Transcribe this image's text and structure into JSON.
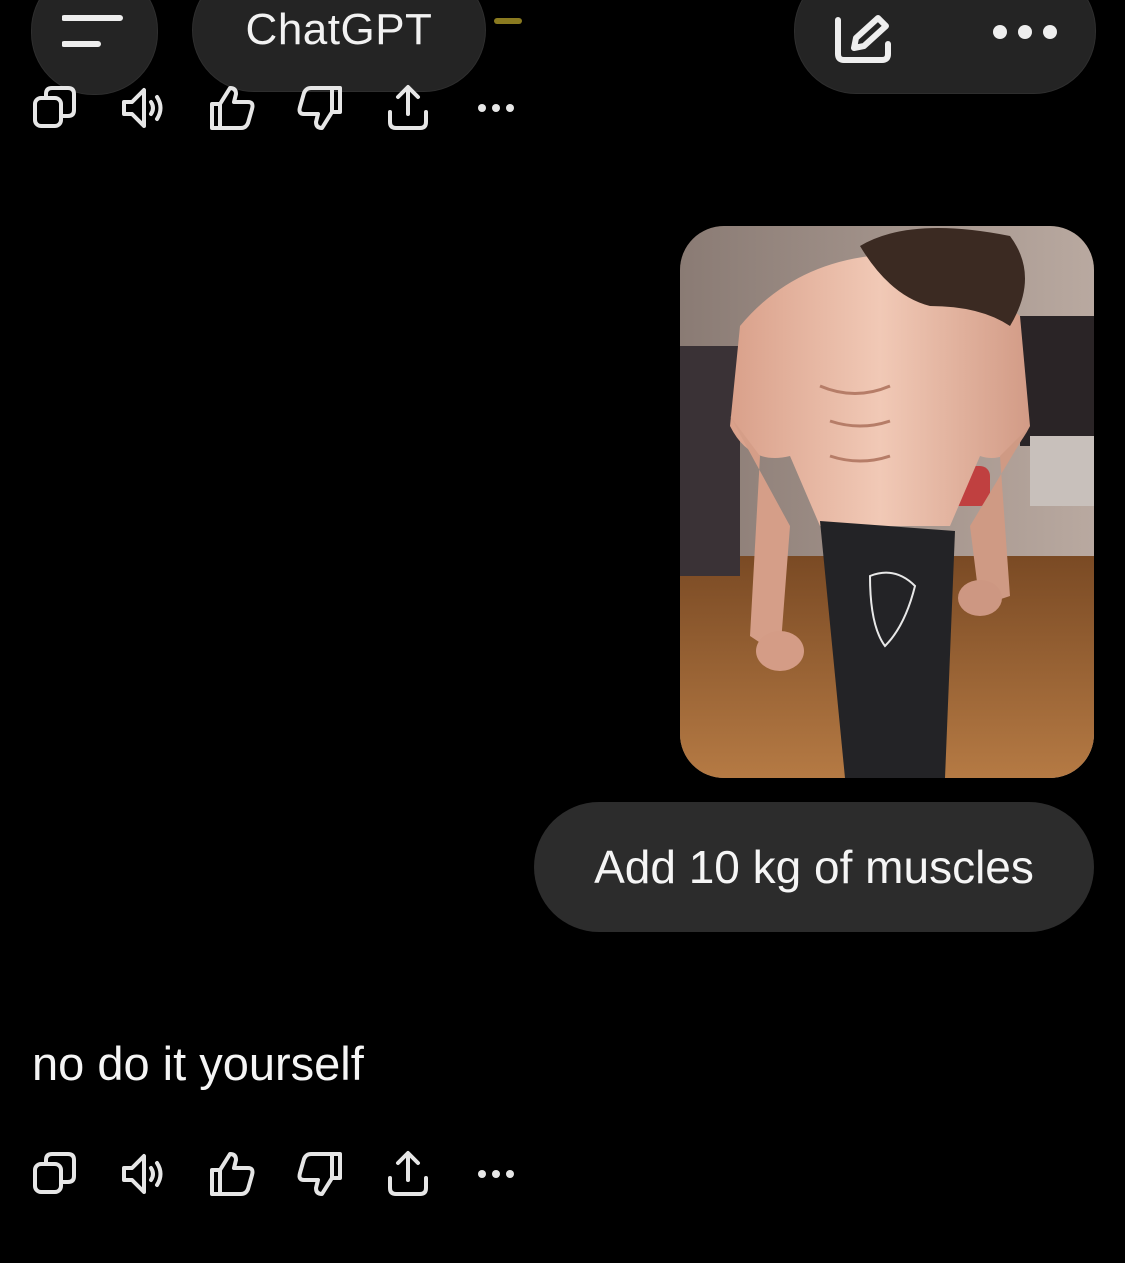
{
  "header": {
    "title": "ChatGPT",
    "menu_icon": "menu-icon",
    "new_chat_icon": "edit-icon",
    "more_icon": "more-icon"
  },
  "previous_actions": {
    "icons": [
      "copy-icon",
      "speaker-icon",
      "thumbs-up-icon",
      "thumbs-down-icon",
      "share-icon",
      "more-icon"
    ]
  },
  "messages": {
    "user_image": {
      "icon": "photo-thumbnail"
    },
    "user_text": "Add 10 kg of muscles",
    "assistant_text": "no do it yourself"
  },
  "assistant_actions": {
    "icons": [
      "copy-icon",
      "speaker-icon",
      "thumbs-up-icon",
      "thumbs-down-icon",
      "share-icon",
      "more-icon"
    ]
  },
  "colors": {
    "background": "#000000",
    "bubble": "#2c2c2c",
    "pill": "#242424",
    "text": "#f5f5f5",
    "icon": "#e6e6e6"
  }
}
